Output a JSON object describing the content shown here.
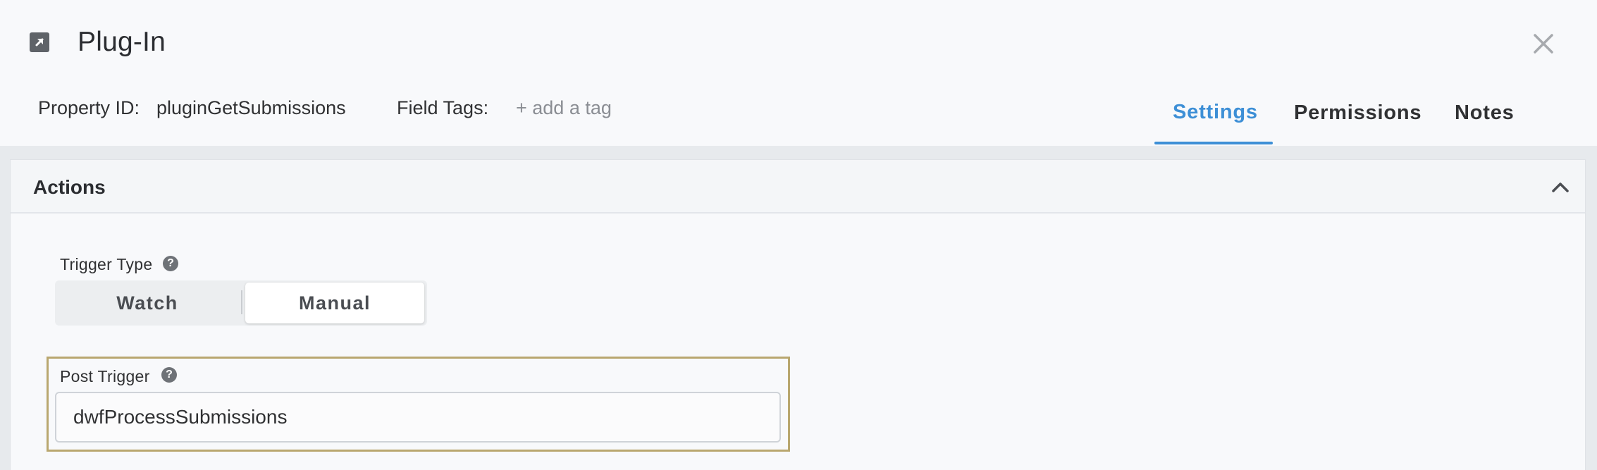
{
  "header": {
    "title": "Plug-In",
    "property_id_label": "Property ID:",
    "property_id_value": "pluginGetSubmissions",
    "field_tags_label": "Field Tags:",
    "add_tag_text": "+ add a tag",
    "tabs": [
      {
        "label": "Settings",
        "active": true
      },
      {
        "label": "Permissions",
        "active": false
      },
      {
        "label": "Notes",
        "active": false
      }
    ],
    "icons": {
      "plugin": "external-link-icon",
      "close": "close-icon"
    }
  },
  "actions_panel": {
    "title": "Actions",
    "collapse_icon": "chevron-up-icon",
    "trigger_type": {
      "label": "Trigger Type",
      "help_icon": "question-circle-icon",
      "options": [
        "Watch",
        "Manual"
      ],
      "selected": "Manual"
    },
    "post_trigger": {
      "label": "Post Trigger",
      "help_icon": "question-circle-icon",
      "value": "dwfProcessSubmissions"
    }
  },
  "colors": {
    "accent": "#3d8fd6",
    "highlight_border": "#b9a76f",
    "background": "#f8f9fb"
  }
}
